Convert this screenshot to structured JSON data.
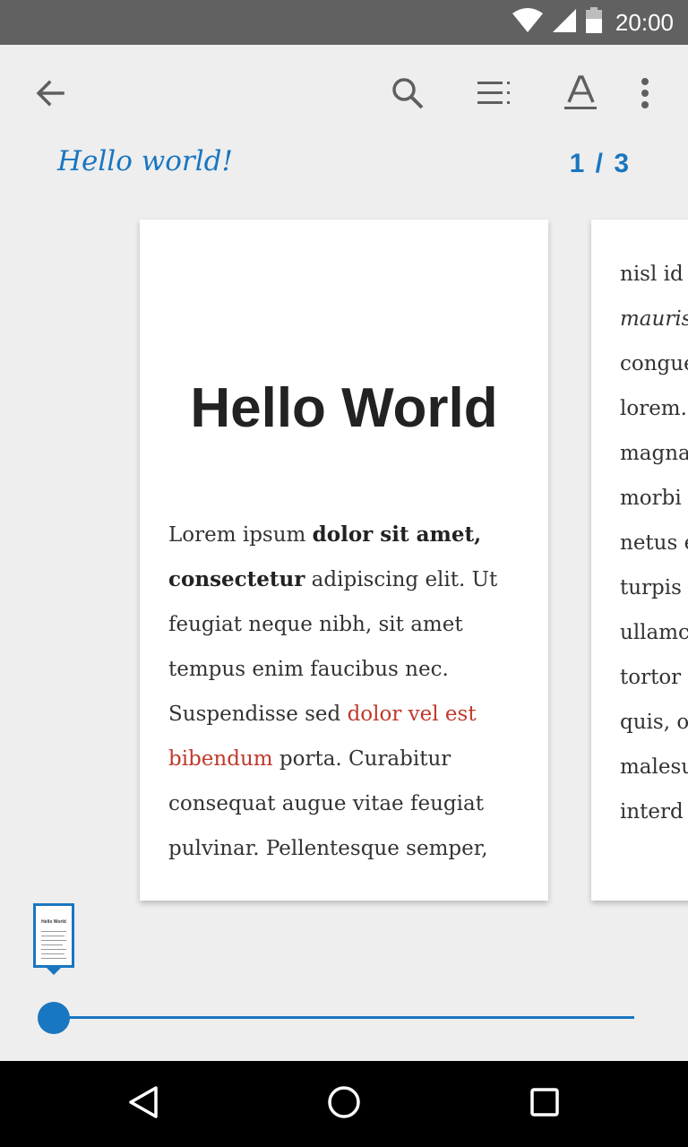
{
  "status_bar": {
    "time": "20:00"
  },
  "toolbar": {
    "back_icon": "arrow-back-icon",
    "search_icon": "search-icon",
    "toc_icon": "toc-icon",
    "text_icon": "text-format-icon",
    "more_icon": "more-vert-icon"
  },
  "book": {
    "title": "Hello world!",
    "page_indicator": "1 / 3"
  },
  "page1": {
    "heading": "Hello World",
    "body": [
      {
        "text": "Lorem ipsum ",
        "style": "normal"
      },
      {
        "text": "dolor sit amet, consectetur",
        "style": "bold"
      },
      {
        "text": " adipiscing elit. Ut feugiat neque nibh, sit amet tempus enim faucibus nec. Suspendisse sed ",
        "style": "normal"
      },
      {
        "text": "dolor vel est bibendum",
        "style": "red"
      },
      {
        "text": " porta. Curabitur consequat augue vitae feugiat pulvinar. Pellentesque semper,",
        "style": "normal"
      }
    ]
  },
  "page2": {
    "lines": [
      {
        "text": "nisl id",
        "style": "normal"
      },
      {
        "text": "mauris",
        "style": "italic"
      },
      {
        "text": "congue",
        "style": "normal"
      },
      {
        "text": "lorem.",
        "style": "normal"
      },
      {
        "text": "magna",
        "style": "normal"
      },
      {
        "text": "morbi",
        "style": "normal"
      },
      {
        "text": "netus e",
        "style": "normal"
      },
      {
        "text": "turpis",
        "style": "normal"
      },
      {
        "text": "ullamc",
        "style": "normal"
      },
      {
        "text": "tortor",
        "style": "normal"
      },
      {
        "text": "quis, o",
        "style": "normal"
      },
      {
        "text": "malesu",
        "style": "normal"
      },
      {
        "text": "interd",
        "style": "normal"
      }
    ]
  },
  "scrubber": {
    "thumbnail_title": "Hello World",
    "progress": 0.0
  },
  "colors": {
    "accent": "#1976c0",
    "link_red": "#c0392b",
    "status_bar": "#616161",
    "background": "#eeeeee"
  },
  "nav_bar": {
    "back_icon": "triangle-back-icon",
    "home_icon": "circle-home-icon",
    "recents_icon": "square-recents-icon"
  }
}
